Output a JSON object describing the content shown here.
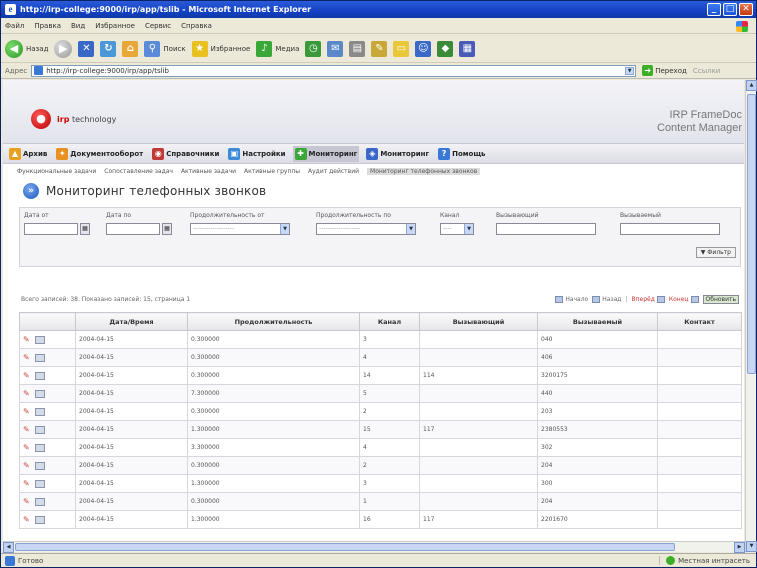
{
  "window": {
    "title": "http://irp-college:9000/irp/app/tslib - Microsoft Internet Explorer",
    "minimize": "_",
    "maximize": "□",
    "close": "✕"
  },
  "menu": [
    "Файл",
    "Правка",
    "Вид",
    "Избранное",
    "Сервис",
    "Справка"
  ],
  "toolbar": {
    "back": "Назад",
    "search": "Поиск",
    "favorites": "Избранное",
    "media": "Медиа"
  },
  "address": {
    "label": "Адрес",
    "url": "http://irp-college:9000/irp/app/tslib",
    "go": "Переход",
    "links": "Ссылки"
  },
  "header": {
    "logo_text_brand": "irp",
    "logo_text_rest": "technology",
    "product_line1": "IRP FrameDoc",
    "product_line2": "Content Manager"
  },
  "nav": [
    {
      "label": "Архив",
      "icon": "archive-icon",
      "color": "#e8a020"
    },
    {
      "label": "Документооборот",
      "icon": "workflow-icon",
      "color": "#e89020"
    },
    {
      "label": "Справочники",
      "icon": "directory-icon",
      "color": "#c03838"
    },
    {
      "label": "Настройки",
      "icon": "settings-icon",
      "color": "#3a8ad8"
    },
    {
      "label": "Мониторинг",
      "icon": "monitoring-icon",
      "color": "#3aa838"
    },
    {
      "label": "Мониторинг",
      "icon": "monitor-icon",
      "color": "#3a68c8"
    },
    {
      "label": "Помощь",
      "icon": "help-icon",
      "color": "#3a78d8"
    }
  ],
  "subnav": [
    "Функциональные задачи",
    "Сопоставление задач",
    "Активные задачи",
    "Активные группы",
    "Аудит действий",
    "Мониторинг телефонных звонков"
  ],
  "page_title": "Мониторинг телефонных звонков",
  "filter": {
    "date_from_label": "Дата от",
    "date_to_label": "Дата по",
    "duration_from_label": "Продолжительность от",
    "duration_to_label": "Продолжительность по",
    "channel_label": "Канал",
    "caller_label": "Вызывающий",
    "callee_label": "Вызываемый",
    "select_placeholder": "-------------------",
    "channel_placeholder": "----",
    "filter_button": "Фильтр"
  },
  "info": "Всего записей: 38. Показано записей: 15, страница 1",
  "pager": {
    "first": "Начало",
    "prev": "Назад",
    "next": "Вперёд",
    "last": "Конец",
    "refresh": "Обновить"
  },
  "table": {
    "columns": [
      "",
      "Дата/Время",
      "Продолжительность",
      "Канал",
      "Вызывающий",
      "Вызываемый",
      "Контакт"
    ],
    "rows": [
      [
        "2004-04-15",
        "0.300000",
        "3",
        "",
        "040",
        ""
      ],
      [
        "2004-04-15",
        "0.300000",
        "4",
        "",
        "406",
        ""
      ],
      [
        "2004-04-15",
        "0.300000",
        "14",
        "114",
        "3200175",
        ""
      ],
      [
        "2004-04-15",
        "7.300000",
        "5",
        "",
        "440",
        ""
      ],
      [
        "2004-04-15",
        "0.300000",
        "2",
        "",
        "203",
        ""
      ],
      [
        "2004-04-15",
        "1.300000",
        "15",
        "117",
        "2380553",
        ""
      ],
      [
        "2004-04-15",
        "3.300000",
        "4",
        "",
        "302",
        ""
      ],
      [
        "2004-04-15",
        "0.300000",
        "2",
        "",
        "204",
        ""
      ],
      [
        "2004-04-15",
        "1.300000",
        "3",
        "",
        "300",
        ""
      ],
      [
        "2004-04-15",
        "0.300000",
        "1",
        "",
        "204",
        ""
      ],
      [
        "2004-04-15",
        "1.300000",
        "16",
        "117",
        "2201670",
        ""
      ]
    ]
  },
  "status": {
    "text": "Готово",
    "zone": "Местная интрасеть"
  }
}
